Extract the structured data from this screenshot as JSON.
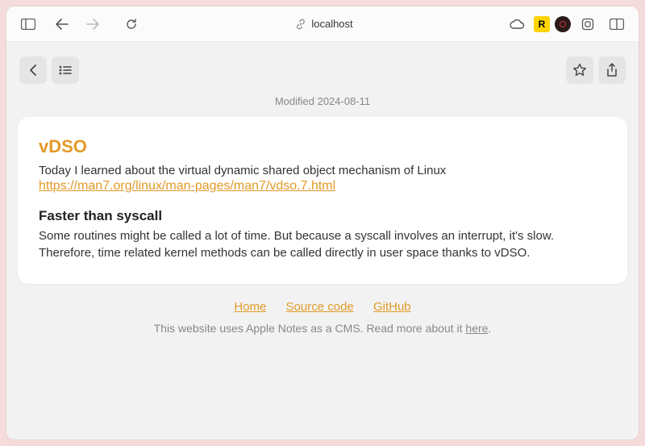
{
  "browser": {
    "address": "localhost",
    "badges": {
      "yellow_letter": "R"
    }
  },
  "note": {
    "modified_label": "Modified 2024-08-11",
    "title": "vDSO",
    "intro": "Today I learned about the virtual dynamic shared object mechanism of Linux",
    "link_text": "https://man7.org/linux/man-pages/man7/vdso.7.html",
    "subtitle": "Faster than syscall",
    "body": "Some routines might be called a lot of time. But because a syscall involves an interrupt, it's slow. Therefore, time related kernel methods can be called directly in user space thanks to vDSO."
  },
  "footer": {
    "links": {
      "home": "Home",
      "source": "Source code",
      "github": "GitHub"
    },
    "cms_text_prefix": "This website uses Apple Notes as a CMS. Read more about it ",
    "cms_here": "here",
    "cms_text_suffix": "."
  }
}
